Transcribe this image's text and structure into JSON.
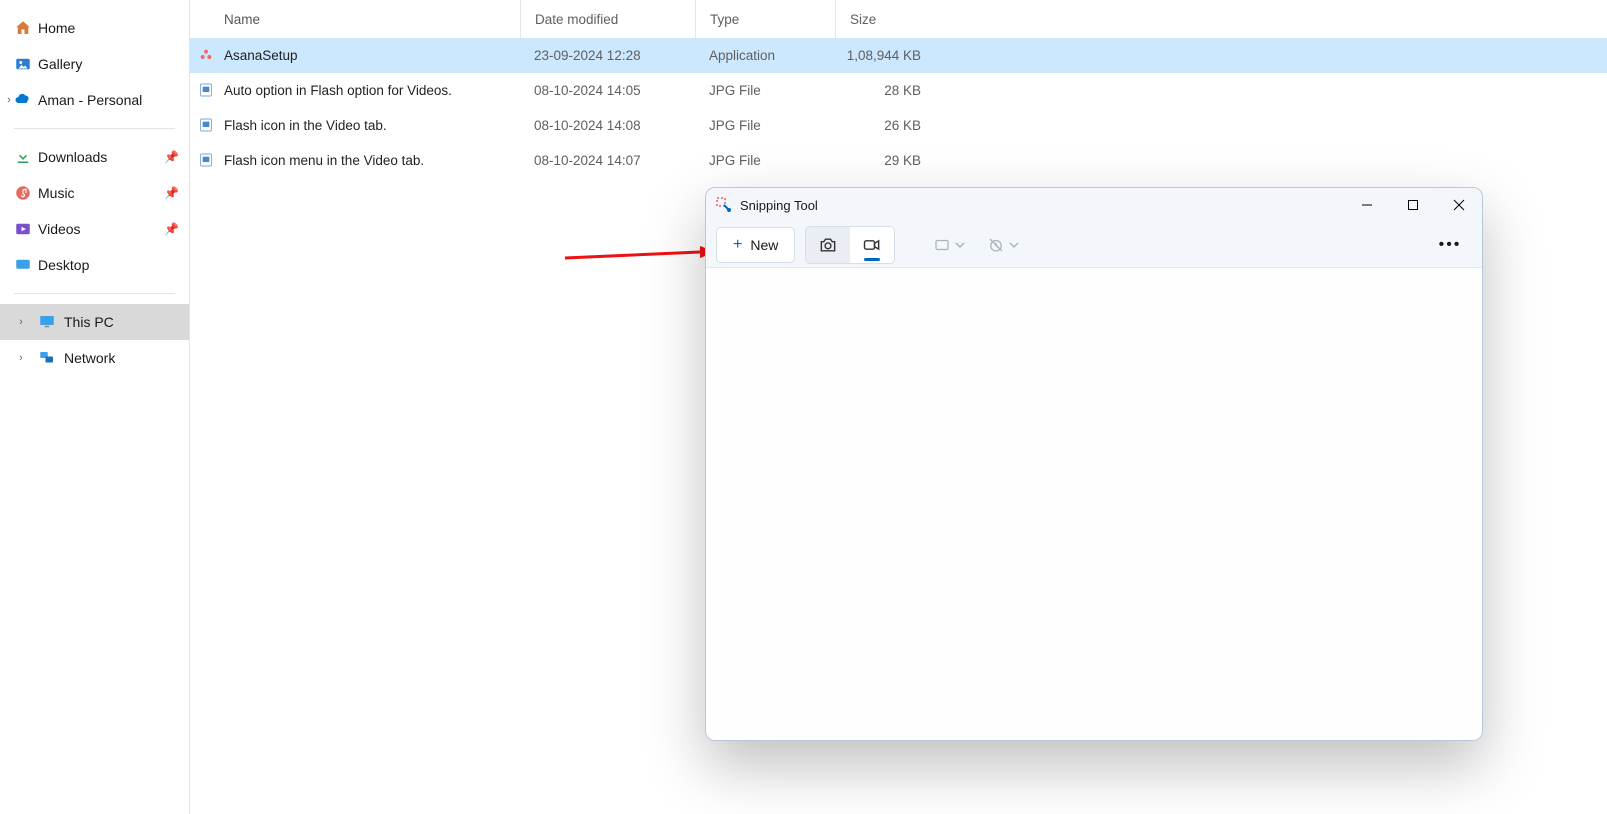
{
  "sidebar": {
    "home": "Home",
    "gallery": "Gallery",
    "personal": "Aman - Personal",
    "downloads": "Downloads",
    "music": "Music",
    "videos": "Videos",
    "desktop": "Desktop",
    "thispc": "This PC",
    "network": "Network"
  },
  "columns": {
    "name": "Name",
    "date": "Date modified",
    "type": "Type",
    "size": "Size"
  },
  "files": [
    {
      "name": "AsanaSetup",
      "date": "23-09-2024 12:28",
      "type": "Application",
      "size": "1,08,944 KB",
      "icon": "asana",
      "selected": true
    },
    {
      "name": "Auto option in Flash option for Videos.",
      "date": "08-10-2024 14:05",
      "type": "JPG File",
      "size": "28 KB",
      "icon": "jpg",
      "selected": false
    },
    {
      "name": "Flash icon in the Video tab.",
      "date": "08-10-2024 14:08",
      "type": "JPG File",
      "size": "26 KB",
      "icon": "jpg",
      "selected": false
    },
    {
      "name": "Flash icon menu in the Video tab.",
      "date": "08-10-2024 14:07",
      "type": "JPG File",
      "size": "29 KB",
      "icon": "jpg",
      "selected": false
    }
  ],
  "snip": {
    "title": "Snipping Tool",
    "new": "New"
  }
}
